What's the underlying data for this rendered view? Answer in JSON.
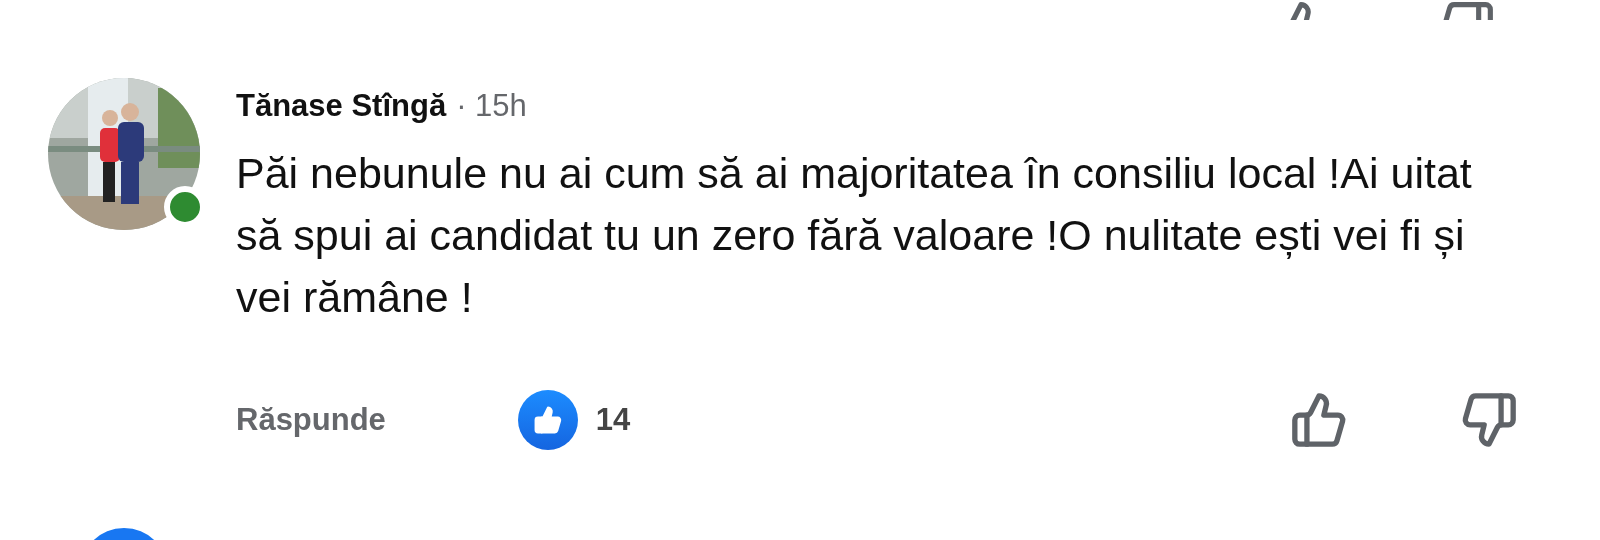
{
  "comment": {
    "author": "Tănase Stîngă",
    "time": "· 15h",
    "online": true,
    "text": "Păi nebunule nu ai cum să ai majoritatea în consiliu local !Ai uitat să spui ai candidat tu un zero fără valoare !O nulitate ești vei fi și vei rămâne !",
    "reply": "Răspunde",
    "like_count": "14"
  }
}
